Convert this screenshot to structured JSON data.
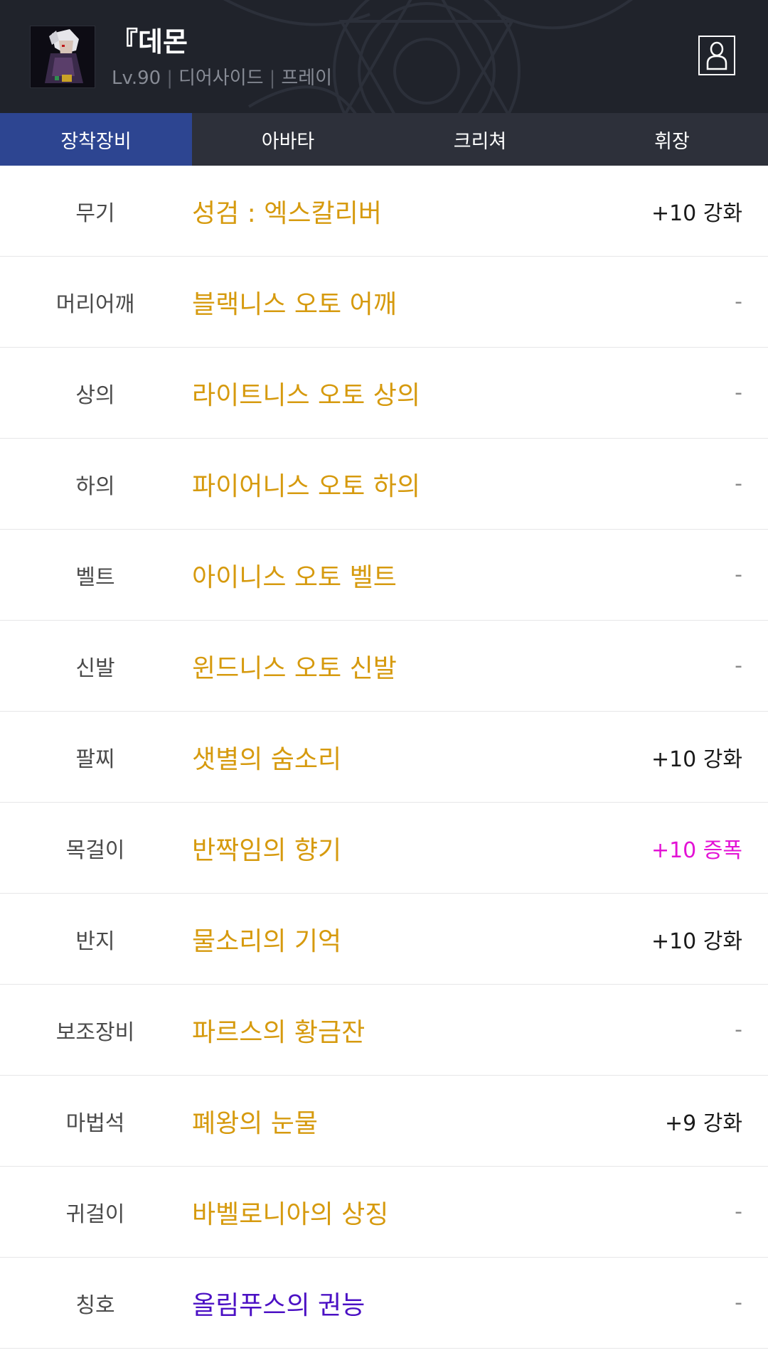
{
  "header": {
    "name": "『데몬",
    "level": "Lv.90",
    "class": "디어사이드",
    "server": "프레이"
  },
  "tabs": [
    {
      "label": "장착장비",
      "active": true
    },
    {
      "label": "아바타",
      "active": false
    },
    {
      "label": "크리쳐",
      "active": false
    },
    {
      "label": "휘장",
      "active": false
    }
  ],
  "equipment": [
    {
      "slot": "무기",
      "item": "성검 : 엑스칼리버",
      "enhance": "+10 강화"
    },
    {
      "slot": "머리어깨",
      "item": "블랙니스 오토 어깨",
      "enhance": "-"
    },
    {
      "slot": "상의",
      "item": "라이트니스 오토 상의",
      "enhance": "-"
    },
    {
      "slot": "하의",
      "item": "파이어니스 오토 하의",
      "enhance": "-"
    },
    {
      "slot": "벨트",
      "item": "아이니스 오토 벨트",
      "enhance": "-"
    },
    {
      "slot": "신발",
      "item": "윈드니스 오토 신발",
      "enhance": "-"
    },
    {
      "slot": "팔찌",
      "item": "샛별의 숨소리",
      "enhance": "+10 강화"
    },
    {
      "slot": "목걸이",
      "item": "반짝임의 향기",
      "enhance": "+10 증폭"
    },
    {
      "slot": "반지",
      "item": "물소리의 기억",
      "enhance": "+10 강화"
    },
    {
      "slot": "보조장비",
      "item": "파르스의 황금잔",
      "enhance": "-"
    },
    {
      "slot": "마법석",
      "item": "폐왕의 눈물",
      "enhance": "+9 강화"
    },
    {
      "slot": "귀걸이",
      "item": "바벨로니아의 상징",
      "enhance": "-"
    },
    {
      "slot": "칭호",
      "item": "올림푸스의 권능",
      "enhance": "-"
    }
  ],
  "icons": {
    "profile": "person-outline-icon",
    "avatar": "character-portrait"
  },
  "colors": {
    "header_bg": "#20232b",
    "tab_bg": "#2d303a",
    "tab_active": "#2d4591",
    "item_name": "#d69a0e",
    "title_item": "#4b10c4",
    "amplify": "#e312d5"
  }
}
